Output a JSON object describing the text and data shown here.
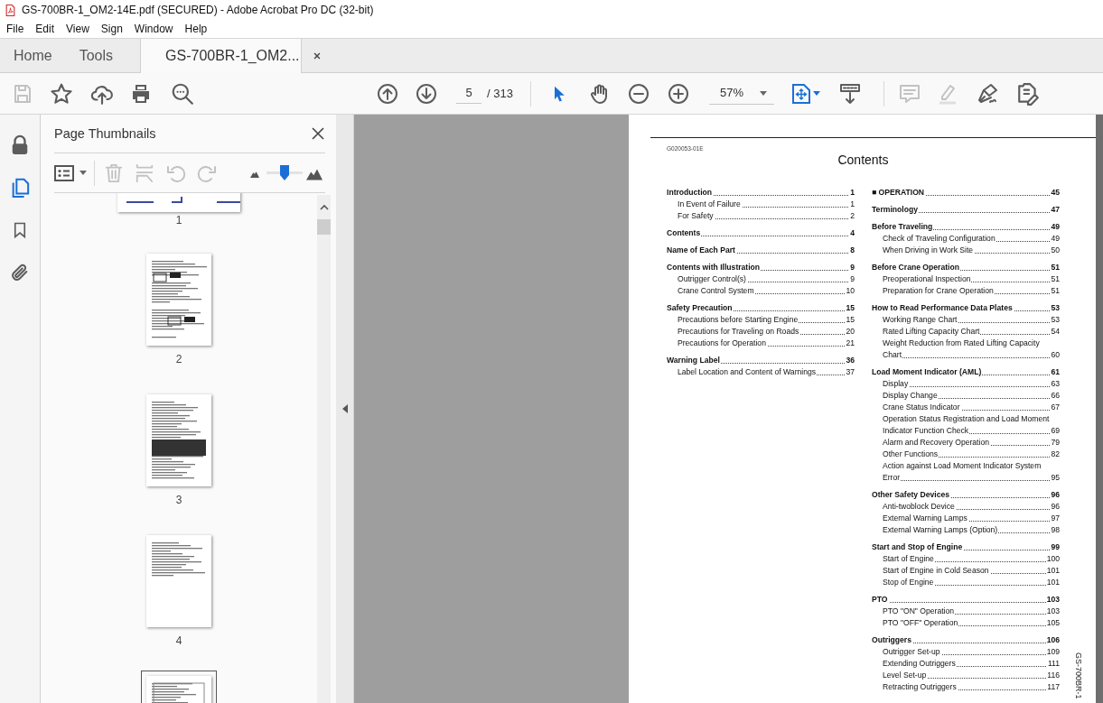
{
  "window": {
    "title": "GS-700BR-1_OM2-14E.pdf (SECURED) - Adobe Acrobat Pro DC (32-bit)"
  },
  "menu": [
    "File",
    "Edit",
    "View",
    "Sign",
    "Window",
    "Help"
  ],
  "tabs": [
    {
      "label": "Home",
      "selected": false,
      "closable": false
    },
    {
      "label": "Tools",
      "selected": false,
      "closable": false
    },
    {
      "label": "GS-700BR-1_OM2...",
      "selected": true,
      "closable": true
    }
  ],
  "toolbar": {
    "page": "5",
    "page_total": "/ 313",
    "zoom": "57%"
  },
  "thumbnails_panel": {
    "title": "Page Thumbnails",
    "thumbnail_size": {
      "level": 0.5
    },
    "thumbnails": [
      {
        "label": "1",
        "selected": false
      },
      {
        "label": "2",
        "selected": false
      },
      {
        "label": "3",
        "selected": false
      },
      {
        "label": "4",
        "selected": false
      },
      {
        "selected": true
      }
    ]
  },
  "document": {
    "code": "G020053-01E",
    "heading": "Contents",
    "side_label": "GS-700BR-1",
    "columns": [
      [
        {
          "title": "Introduction",
          "page": "1",
          "entries": [
            {
              "title": "In Event of Failure",
              "page": "1"
            },
            {
              "title": "For Safety",
              "page": "2"
            }
          ]
        },
        {
          "title": "Contents",
          "page": "4"
        },
        {
          "title": "Name of Each Part",
          "page": "8"
        },
        {
          "title": "Contents with Illustration",
          "page": "9",
          "entries": [
            {
              "title": "Outrigger Control(s)",
              "page": "9"
            },
            {
              "title": "Crane Control System",
              "page": "10"
            }
          ]
        },
        {
          "title": "Safety Precaution",
          "page": "15",
          "entries": [
            {
              "title": "Precautions before Starting Engine",
              "page": "15"
            },
            {
              "title": "Precautions for Traveling on Roads",
              "page": "20"
            },
            {
              "title": "Precautions for Operation",
              "page": "21"
            }
          ]
        },
        {
          "title": "Warning Label",
          "page": "36",
          "entries": [
            {
              "title": "Label Location and Content of Warnings",
              "page": "37"
            }
          ]
        }
      ],
      [
        {
          "title": "■ OPERATION",
          "page": "45"
        },
        {
          "title": "Terminology",
          "page": "47"
        },
        {
          "title": "Before Traveling",
          "page": "49",
          "entries": [
            {
              "title": "Check of Traveling Configuration",
              "page": "49"
            },
            {
              "title": "When Driving in Work Site",
              "page": "50"
            }
          ]
        },
        {
          "title": "Before Crane Operation",
          "page": "51",
          "entries": [
            {
              "title": "Preoperational Inspection",
              "page": "51"
            },
            {
              "title": "Preparation for Crane Operation",
              "page": "51"
            }
          ]
        },
        {
          "title": "How to Read Performance Data Plates",
          "page": "53",
          "entries": [
            {
              "title": "Working Range Chart",
              "page": "53"
            },
            {
              "title": "Rated Lifting Capacity Chart",
              "page": "54"
            },
            {
              "title": "Weight Reduction from Rated Lifting Capacity Chart",
              "page": "60"
            }
          ]
        },
        {
          "title": "Load Moment Indicator (AML)",
          "page": "61",
          "entries": [
            {
              "title": "Display",
              "page": "63"
            },
            {
              "title": "Display Change",
              "page": "66"
            },
            {
              "title": "Crane Status Indicator",
              "page": "67"
            },
            {
              "title": "Operation Status Registration and Load Moment Indicator Function Check",
              "page": "69"
            },
            {
              "title": "Alarm and Recovery Operation",
              "page": "79"
            },
            {
              "title": "Other Functions",
              "page": "82"
            },
            {
              "title": "Action against Load Moment Indicator System Error",
              "page": "95"
            }
          ]
        },
        {
          "title": "Other Safety Devices",
          "page": "96",
          "entries": [
            {
              "title": "Anti-twoblock Device",
              "page": "96"
            },
            {
              "title": "External Warning Lamps",
              "page": "97"
            },
            {
              "title": "External Warning Lamps (Option)",
              "page": "98"
            }
          ]
        },
        {
          "title": "Start and Stop of Engine",
          "page": "99",
          "entries": [
            {
              "title": "Start of Engine",
              "page": "100"
            },
            {
              "title": "Start of Engine in Cold Season",
              "page": "101"
            },
            {
              "title": "Stop of Engine",
              "page": "101"
            }
          ]
        },
        {
          "title": "PTO",
          "page": "103",
          "entries": [
            {
              "title": "PTO \"ON\" Operation",
              "page": "103"
            },
            {
              "title": "PTO \"OFF\" Operation",
              "page": "105"
            }
          ]
        },
        {
          "title": "Outriggers",
          "page": "106",
          "entries": [
            {
              "title": "Outrigger Set-up",
              "page": "109"
            },
            {
              "title": "Extending Outriggers",
              "page": "111"
            },
            {
              "title": "Level Set-up",
              "page": "116"
            },
            {
              "title": "Retracting Outriggers",
              "page": "117"
            }
          ]
        }
      ]
    ]
  }
}
